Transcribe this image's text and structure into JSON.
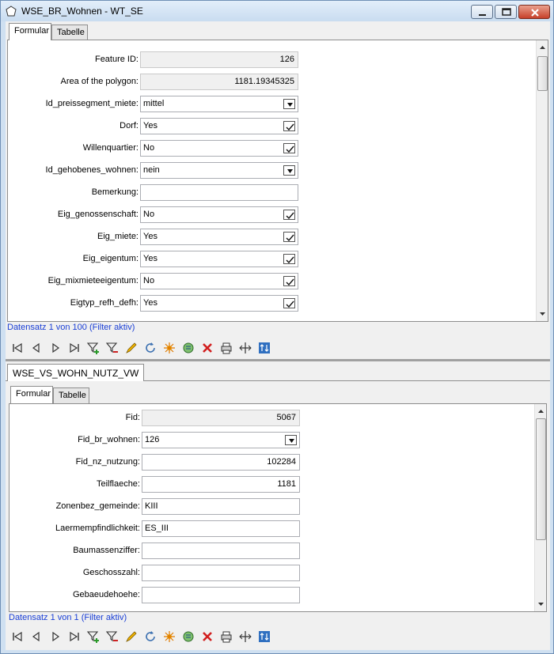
{
  "window": {
    "title": "WSE_BR_Wohnen - WT_SE"
  },
  "top": {
    "tabs": [
      {
        "label": "Formular"
      },
      {
        "label": "Tabelle"
      }
    ],
    "fields": [
      {
        "label": "Feature ID:",
        "value": "126"
      },
      {
        "label": "Area of the polygon:",
        "value": "1181.19345325"
      },
      {
        "label": "Id_preissegment_miete:",
        "value": "mittel"
      },
      {
        "label": "Dorf:",
        "value": "Yes"
      },
      {
        "label": "Willenquartier:",
        "value": "No"
      },
      {
        "label": "Id_gehobenes_wohnen:",
        "value": "nein"
      },
      {
        "label": "Bemerkung:",
        "value": ""
      },
      {
        "label": "Eig_genossenschaft:",
        "value": "No"
      },
      {
        "label": "Eig_miete:",
        "value": "Yes"
      },
      {
        "label": "Eig_eigentum:",
        "value": "Yes"
      },
      {
        "label": "Eig_mixmieteeigentum:",
        "value": "No"
      },
      {
        "label": "Eigtyp_refh_defh:",
        "value": "Yes"
      }
    ],
    "status": "Datensatz 1 von 100 (Filter aktiv)"
  },
  "bottom": {
    "title": "WSE_VS_WOHN_NUTZ_VW",
    "tabs": [
      {
        "label": "Formular"
      },
      {
        "label": "Tabelle"
      }
    ],
    "fields": [
      {
        "label": "Fid:",
        "value": "5067"
      },
      {
        "label": "Fid_br_wohnen:",
        "value": "126"
      },
      {
        "label": "Fid_nz_nutzung:",
        "value": "102284"
      },
      {
        "label": "Teilflaeche:",
        "value": "1181"
      },
      {
        "label": "Zonenbez_gemeinde:",
        "value": "KIII"
      },
      {
        "label": "Laermempfindlichkeit:",
        "value": "ES_III"
      },
      {
        "label": "Baumassenziffer:",
        "value": ""
      },
      {
        "label": "Geschosszahl:",
        "value": ""
      },
      {
        "label": "Gebaeudehoehe:",
        "value": ""
      }
    ],
    "status": "Datensatz 1 von 1 (Filter aktiv)"
  },
  "toolbar_icons": [
    "first-record-icon",
    "previous-record-icon",
    "next-record-icon",
    "last-record-icon",
    "filter-add-icon",
    "filter-remove-icon",
    "edit-pencil-icon",
    "refresh-icon",
    "new-record-icon",
    "zoom-to-icon",
    "delete-icon",
    "print-icon",
    "pan-to-icon",
    "switch-view-icon"
  ],
  "colors": {
    "status_text": "#1a3fd6",
    "accent": "#c7402a"
  }
}
